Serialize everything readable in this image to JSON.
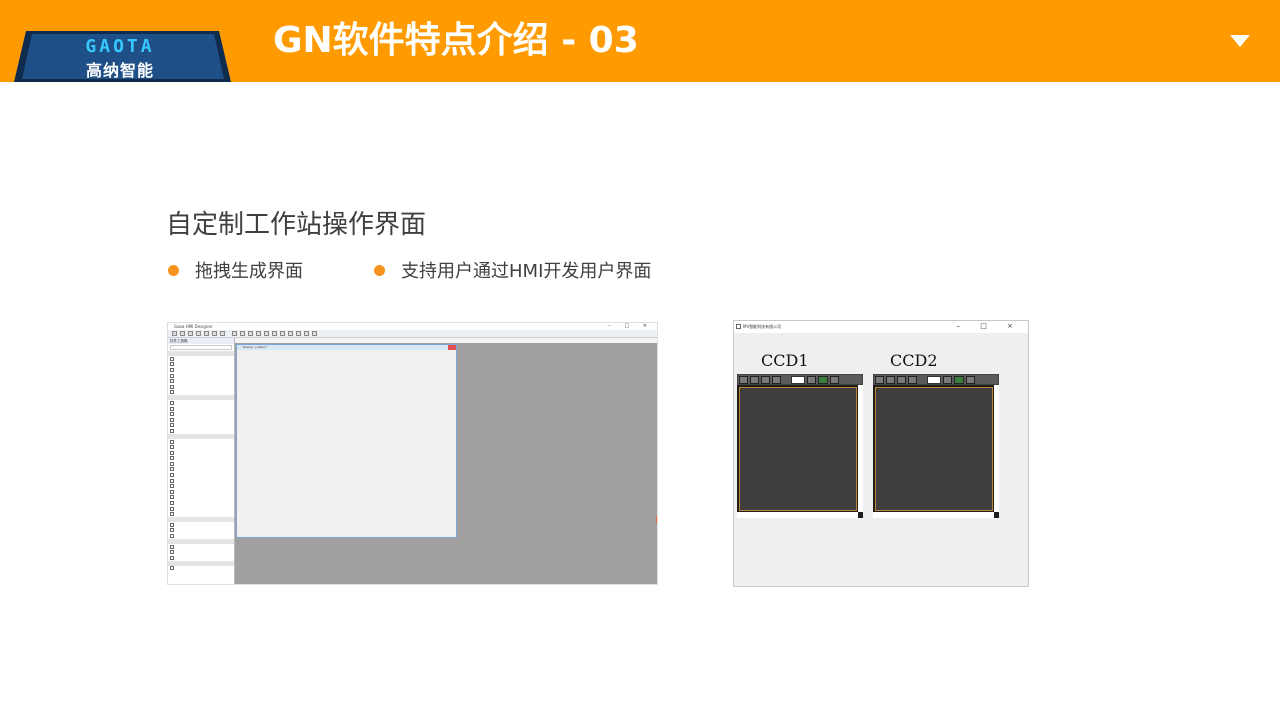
{
  "header": {
    "logo": {
      "brand_en": "GAOTA",
      "brand_cn": "高纳智能"
    },
    "title": "GN软件特点介绍 - 03",
    "menu_icon": "chevron-down-icon"
  },
  "content": {
    "section_title": "自定制工作站操作界面",
    "bullets": [
      {
        "label": "拖拽生成界面"
      },
      {
        "label": "支持用户通过HMI开发用户界面"
      }
    ]
  },
  "screenshot_designer": {
    "window_title": "Gaoa HMI Designer",
    "sidebar_title": "控件工具箱",
    "dialog_title": "Dialog - [main]*"
  },
  "screenshot_runtime": {
    "window_title": "MV智能科技有限公司",
    "cameras": [
      {
        "label": "CCD1",
        "input_value": "0"
      },
      {
        "label": "CCD2",
        "input_value": "0"
      }
    ]
  },
  "colors": {
    "header_bg": "#ff9a00",
    "bullet_dot": "#f7931e",
    "logo_accent": "#36c8ff"
  }
}
